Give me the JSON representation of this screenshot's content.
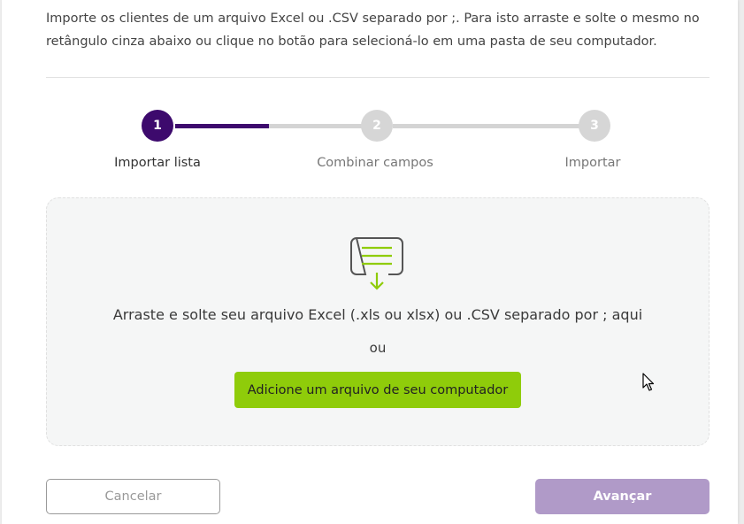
{
  "intro": {
    "text": "Importe os clientes de um arquivo Excel ou .CSV separado por ;. Para isto arraste e solte o mesmo no retângulo cinza abaixo ou clique no botão para selecioná-lo em uma pasta de seu computador."
  },
  "stepper": {
    "progress": 0.5,
    "steps": [
      {
        "number": "1",
        "label": "Importar lista",
        "active": true
      },
      {
        "number": "2",
        "label": "Combinar campos",
        "active": false
      },
      {
        "number": "3",
        "label": "Importar",
        "active": false
      }
    ]
  },
  "dropzone": {
    "icon": "file-download-icon",
    "instruction": "Arraste e solte seu arquivo Excel (.xls ou xlsx) ou .CSV separado por ; aqui",
    "or_text": "ou",
    "add_button_label": "Adicione um arquivo de seu computador"
  },
  "footer": {
    "cancel_label": "Cancelar",
    "next_label": "Avançar"
  },
  "colors": {
    "primary": "#3d0a6d",
    "accent_green": "#8fcc0a",
    "next_disabled": "#b09ac8",
    "step_inactive": "#d6d6d6",
    "dropzone_bg": "#f5f6f6"
  }
}
